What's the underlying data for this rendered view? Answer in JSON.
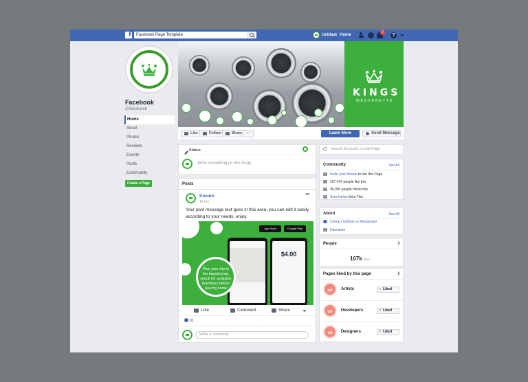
{
  "topbar": {
    "search_value": "Facebook Page Template",
    "user_name": "Unblast",
    "home_label": "Home",
    "notification_count": "2",
    "help_glyph": "?"
  },
  "left": {
    "page_name": "Facebook",
    "page_handle": "@facebook",
    "nav": [
      "Home",
      "About",
      "Photos",
      "Reviews",
      "Events",
      "Posts",
      "Community"
    ],
    "create_page": "Create a Page"
  },
  "cover": {
    "brand": "KINGS",
    "tagline": "WASHERETTE"
  },
  "actions": {
    "like": "Like",
    "follow": "Follow",
    "share": "Share",
    "more": "···",
    "learn_more": "Learn More",
    "send_message": "Send Message"
  },
  "status": {
    "tab": "Status",
    "placeholder": "Write something on this Page"
  },
  "posts": {
    "header": "Posts",
    "author": "Envato",
    "time": "16 hrs",
    "text": "Your post message text goes in this area, you can edit it easily according to your needs, enjoy.",
    "app_store": "App Store",
    "google_play": "Google Play",
    "price": "$4.00",
    "callout": "Plan your trip to the laundromat, check for available machines before leaving home",
    "like": "Like",
    "comment": "Comment",
    "share": "Share",
    "likes_count": "82",
    "comment_placeholder": "Write a comment..."
  },
  "sidebar": {
    "search_placeholder": "Search for posts on this Page",
    "community": {
      "title": "Community",
      "see_all": "See All",
      "invite_link": "Invite your friends",
      "invite_rest": " to like this Page",
      "likes": "107,476 people like this",
      "follows": "99,000 people follow this",
      "friend_name": "Sara Helwe",
      "friend_rest": " likes This"
    },
    "about": {
      "title": "About",
      "see_all": "See All",
      "contact": "Contact Unblast on Messenger",
      "category": "Education"
    },
    "people": {
      "title": "People",
      "count": "107k",
      "count_label": "likes"
    },
    "pages_liked": {
      "title": "Pages liked by this page",
      "items": [
        {
          "initials": "un",
          "name": "Artists",
          "button": "Liked"
        },
        {
          "initials": "un",
          "name": "Developers",
          "button": "Liked"
        },
        {
          "initials": "un",
          "name": "Designers",
          "button": "Liked"
        }
      ]
    }
  },
  "colors": {
    "fb_blue": "#4267b2",
    "brand_green": "#3caf3c",
    "background": "#e9ebee"
  }
}
